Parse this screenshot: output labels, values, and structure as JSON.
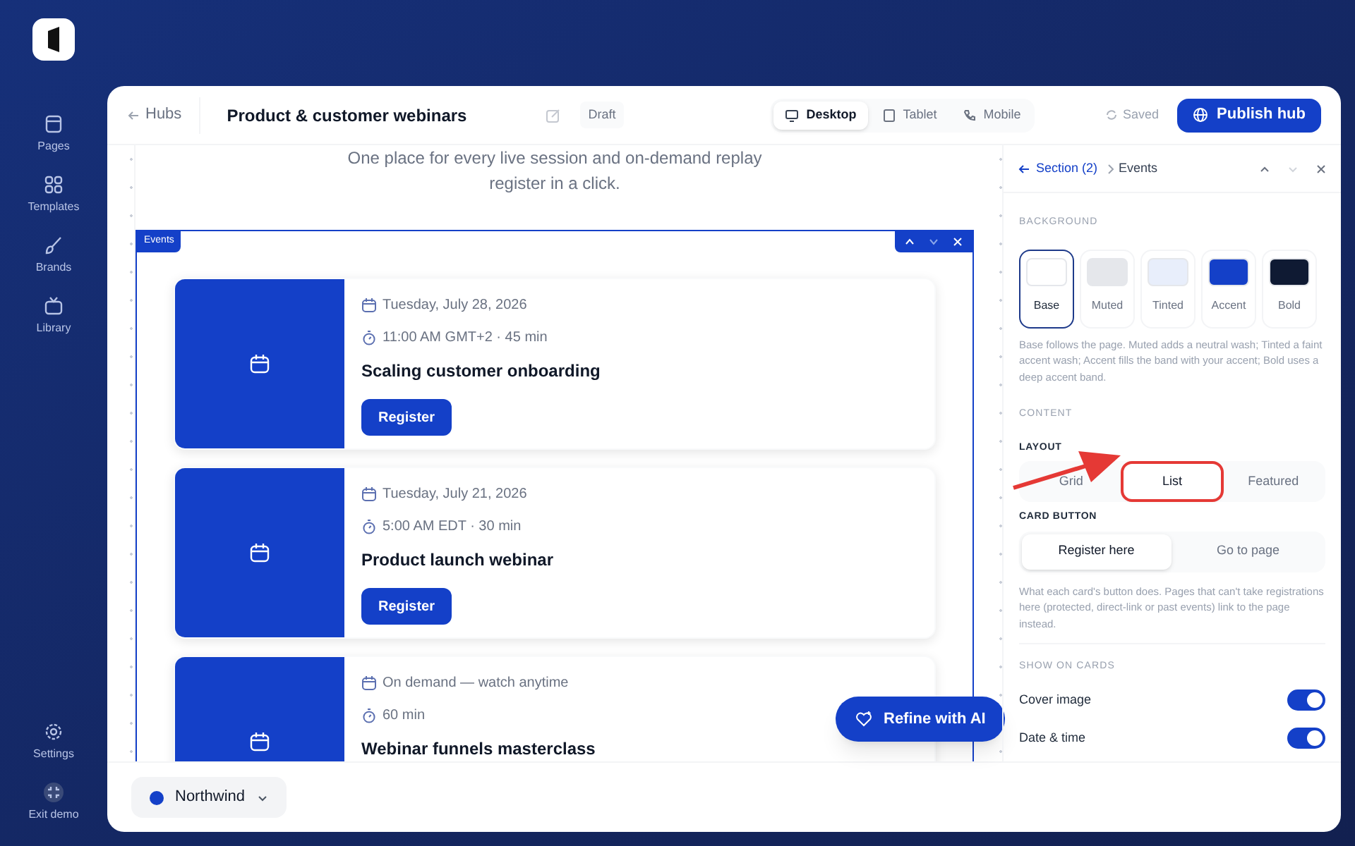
{
  "sidebar": {
    "items": [
      {
        "label": "Pages",
        "kind": "pages"
      },
      {
        "label": "Templates",
        "kind": "templates"
      },
      {
        "label": "Brands",
        "kind": "brands"
      },
      {
        "label": "Library",
        "kind": "library"
      }
    ],
    "footer": [
      {
        "label": "Settings",
        "kind": "settings"
      },
      {
        "label": "Exit demo",
        "kind": "exit"
      }
    ]
  },
  "header": {
    "back": "Hubs",
    "title": "Product & customer webinars",
    "status": "Draft",
    "devices": [
      {
        "label": "Desktop",
        "kind": "desktop",
        "selected": true
      },
      {
        "label": "Tablet",
        "kind": "tablet",
        "selected": false
      },
      {
        "label": "Mobile",
        "kind": "mobile",
        "selected": false
      }
    ],
    "save_state": "Saved",
    "publish": "Publish hub"
  },
  "canvas": {
    "intro": [
      "One place for every live session and on-demand replay",
      "register in a click."
    ],
    "section_tag": "Events",
    "events": [
      {
        "date": "Tuesday, July 28, 2026",
        "time": "11:00 AM GMT+2 · 45 min",
        "title": "Scaling customer onboarding",
        "button": "Register"
      },
      {
        "date": "Tuesday, July 21, 2026",
        "time": "5:00 AM EDT · 30 min",
        "title": "Product launch webinar",
        "button": "Register"
      },
      {
        "date": "On demand — watch anytime",
        "time": "60 min",
        "title": "Webinar funnels masterclass"
      }
    ],
    "ai_button": "Refine with AI"
  },
  "workspace": {
    "name": "Northwind",
    "color": "#1440c8"
  },
  "panel": {
    "breadcrumb": {
      "back": "Section (2)",
      "current": "Events"
    },
    "background": {
      "heading": "BACKGROUND",
      "options": [
        {
          "label": "Base",
          "color": "#ffffff",
          "selected": true
        },
        {
          "label": "Muted",
          "color": "#e5e7eb",
          "selected": false
        },
        {
          "label": "Tinted",
          "color": "#e8eefb",
          "selected": false
        },
        {
          "label": "Accent",
          "color": "#1440c8",
          "selected": false
        },
        {
          "label": "Bold",
          "color": "#0f1a33",
          "selected": false
        }
      ],
      "help": "Base follows the page. Muted adds a neutral wash; Tinted a faint accent wash; Accent fills the band with your accent; Bold uses a deep accent band."
    },
    "content_heading": "CONTENT",
    "layout": {
      "heading": "LAYOUT",
      "options": [
        {
          "label": "Grid",
          "selected": false,
          "highlighted": false
        },
        {
          "label": "List",
          "selected": true,
          "highlighted": true
        },
        {
          "label": "Featured",
          "selected": false,
          "highlighted": false
        }
      ]
    },
    "card_button": {
      "heading": "CARD BUTTON",
      "options": [
        {
          "label": "Register here",
          "selected": true
        },
        {
          "label": "Go to page",
          "selected": false
        }
      ],
      "help": "What each card's button does. Pages that can't take registrations here (protected, direct-link or past events) link to the page instead."
    },
    "show_heading": "SHOW ON CARDS",
    "toggles": [
      {
        "label": "Cover image",
        "on": true
      },
      {
        "label": "Date & time",
        "on": true
      }
    ]
  }
}
